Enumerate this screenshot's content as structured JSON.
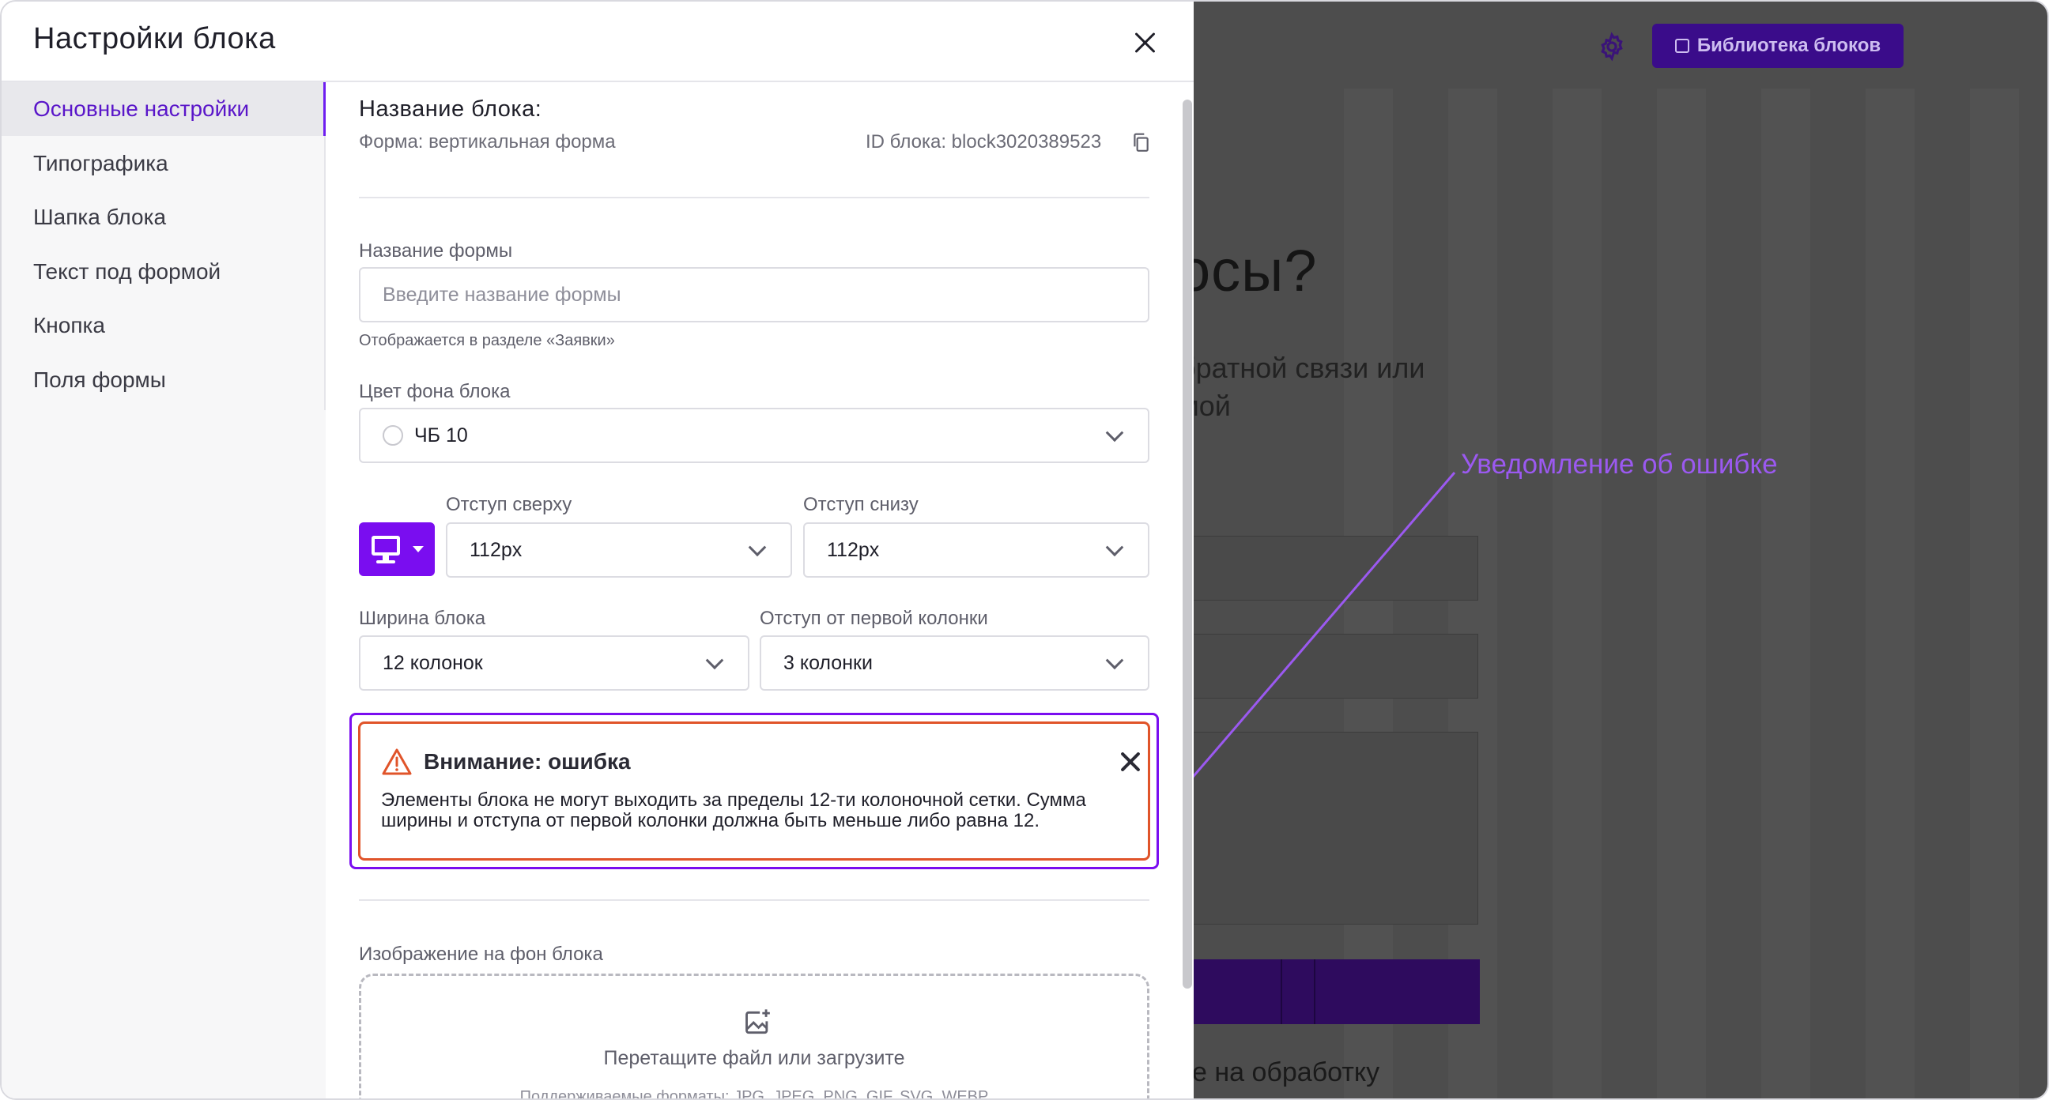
{
  "modal": {
    "title": "Настройки блока",
    "sidebar": {
      "items": [
        {
          "label": "Основные настройки",
          "active": true
        },
        {
          "label": "Типографика"
        },
        {
          "label": "Шапка блока"
        },
        {
          "label": "Текст под формой"
        },
        {
          "label": "Кнопка"
        },
        {
          "label": "Поля формы"
        }
      ]
    },
    "content": {
      "block_name_label": "Название блока:",
      "form_type": "Форма: вертикальная форма",
      "block_id": "ID блока: block3020389523",
      "form_name": {
        "label": "Название формы",
        "placeholder": "Введите название формы",
        "value": "",
        "hint": "Отображается в разделе «Заявки»"
      },
      "bg_color": {
        "label": "Цвет фона блока",
        "value": "ЧБ 10"
      },
      "padding_top": {
        "label": "Отступ сверху",
        "value": "112px"
      },
      "padding_bottom": {
        "label": "Отступ снизу",
        "value": "112px"
      },
      "block_width": {
        "label": "Ширина блока",
        "value": "12 колонок"
      },
      "first_column_offset": {
        "label": "Отступ от первой колонки",
        "value": "3 колонки"
      },
      "alert": {
        "title": "Внимание: ошибка",
        "text": "Элементы блока не могут выходить за пределы 12-ти колоночной сетки. Сумма ширины и отступа от первой колонки должна быть меньше либо равна 12."
      },
      "bg_image": {
        "label": "Изображение на фон блока",
        "dropzone_text": "Перетащите файл или загрузите",
        "formats": "Поддерживаемые форматы: JPG, JPEG, PNG, GIF, SVG, WEBP"
      }
    }
  },
  "background_page": {
    "library_button": "Библиотека блоков",
    "heading_fragment": "осы?",
    "subtitle_lines": [
      "братной связи или",
      "мой"
    ],
    "footer_fragment": "е на обработку"
  },
  "annotation": {
    "text": "Уведомление об ошибке"
  },
  "colors": {
    "accent": "#7a0df0",
    "error_border": "#e0542a",
    "annotation": "#9b59f0",
    "overlay": "#4d4d4d"
  }
}
